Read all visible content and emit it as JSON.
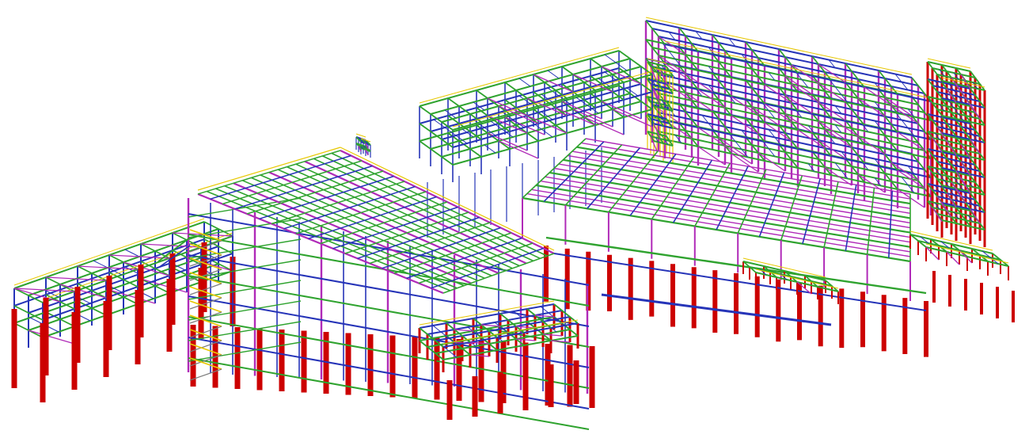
{
  "image": {
    "background": "#ffffff",
    "subject": "isometric-steel-structure-3d-model"
  },
  "colors": {
    "column_red": "#cc0000",
    "beam_green": "#2fa32f",
    "bracing_magenta": "#b02ab8",
    "purlin_blue": "#2634b8",
    "handrail_yellow": "#e8c800",
    "grating_grey": "#7a7a7a"
  },
  "structures": [
    {
      "id": "left-pipe-rack",
      "kind": "pipe-rack"
    },
    {
      "id": "center-main-building",
      "kind": "sloped-roof-building"
    },
    {
      "id": "upper-gallery-frame",
      "kind": "conveyor-gallery"
    },
    {
      "id": "right-large-hall",
      "kind": "sloped-roof-hall"
    },
    {
      "id": "right-tall-tower",
      "kind": "multi-level-tower"
    },
    {
      "id": "right-platform",
      "kind": "access-platform"
    }
  ]
}
